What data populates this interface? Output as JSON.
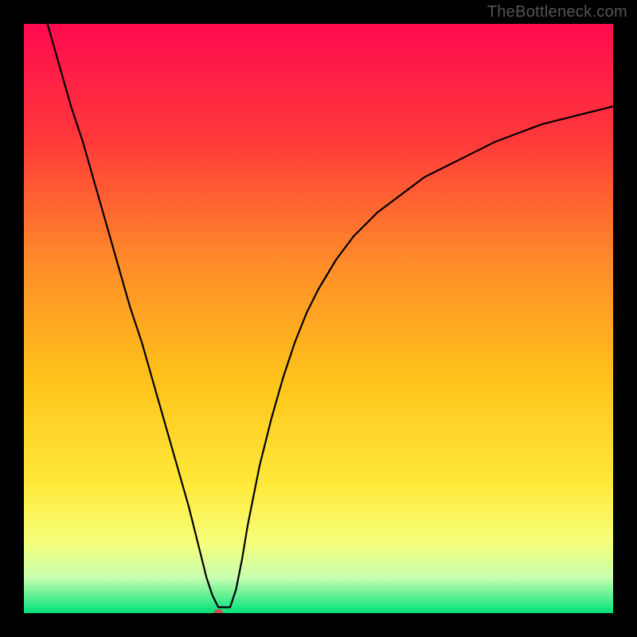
{
  "watermark": "TheBottleneck.com",
  "chart_data": {
    "type": "line",
    "title": "",
    "xlabel": "",
    "ylabel": "",
    "xlim": [
      0,
      100
    ],
    "ylim": [
      0,
      100
    ],
    "background_gradient": {
      "stops": [
        {
          "offset": 0,
          "color": "#ff0a4f"
        },
        {
          "offset": 20,
          "color": "#ff3a3a"
        },
        {
          "offset": 40,
          "color": "#ff8a2a"
        },
        {
          "offset": 60,
          "color": "#ffc21a"
        },
        {
          "offset": 78,
          "color": "#ffe93a"
        },
        {
          "offset": 88,
          "color": "#f6ff7a"
        },
        {
          "offset": 94,
          "color": "#c8ffb0"
        },
        {
          "offset": 100,
          "color": "#00e07a"
        }
      ]
    },
    "marker": {
      "x": 33,
      "y": 0,
      "color": "#c74b4b",
      "rx": 6,
      "ry": 5
    },
    "series": [
      {
        "name": "bottleneck-curve",
        "color": "#000000",
        "width": 2.2,
        "x": [
          4,
          6,
          8,
          10,
          12,
          14,
          16,
          18,
          20,
          22,
          24,
          26,
          28,
          29,
          30,
          31,
          32,
          33,
          34,
          35,
          36,
          37,
          38,
          40,
          42,
          44,
          46,
          48,
          50,
          53,
          56,
          60,
          64,
          68,
          72,
          76,
          80,
          84,
          88,
          92,
          96,
          100
        ],
        "y": [
          100,
          93,
          86,
          80,
          73,
          66,
          59,
          52,
          46,
          39,
          32,
          25,
          18,
          14,
          10,
          6,
          3,
          1,
          1,
          1,
          4,
          9,
          15,
          25,
          33,
          40,
          46,
          51,
          55,
          60,
          64,
          68,
          71,
          74,
          76,
          78,
          80,
          81.5,
          83,
          84,
          85,
          86
        ]
      }
    ]
  }
}
